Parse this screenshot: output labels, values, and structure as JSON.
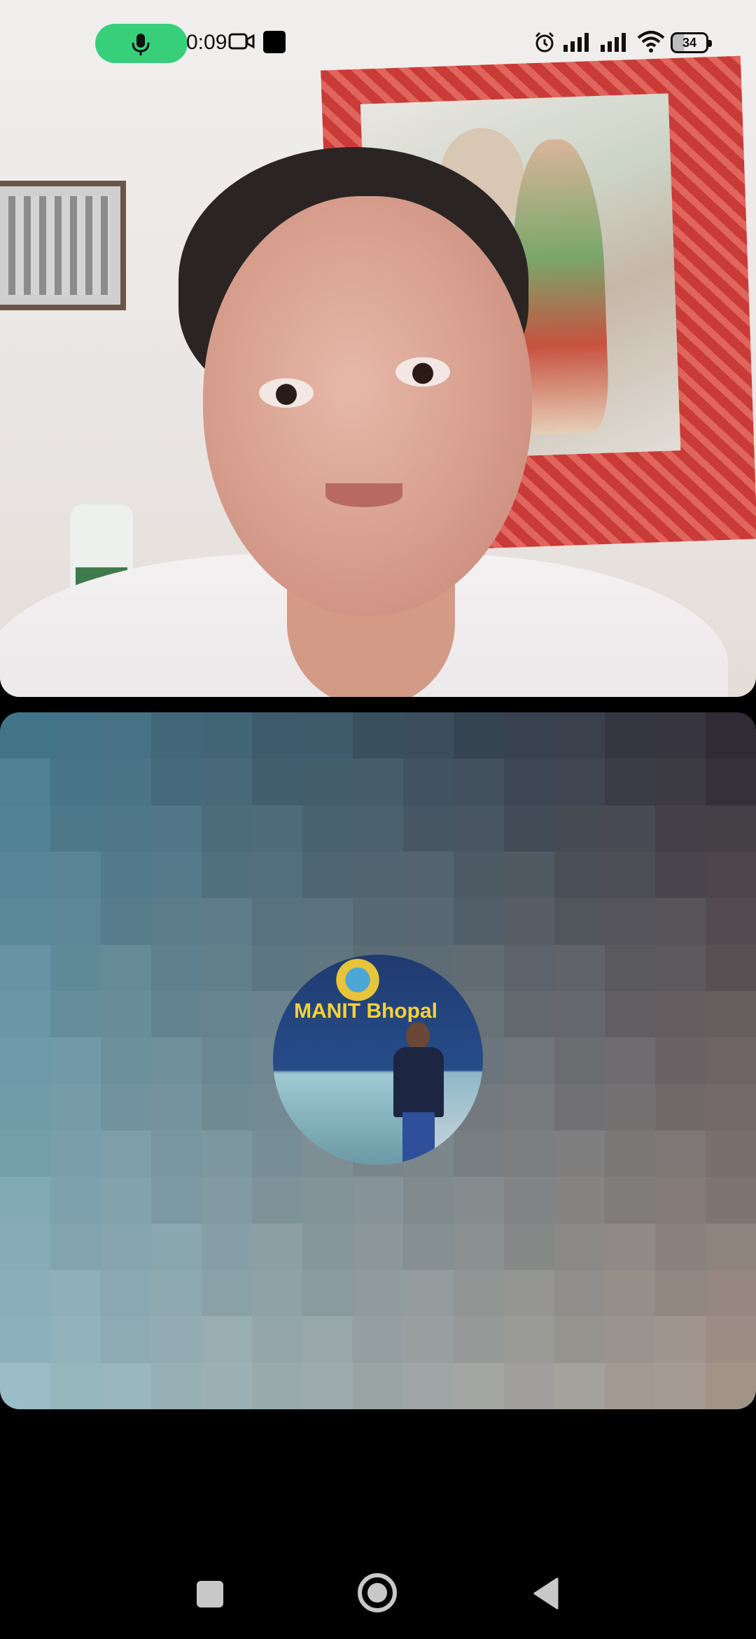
{
  "status_bar": {
    "time": "0:09",
    "battery_level": "34",
    "icons": [
      "microphone-icon",
      "camera-icon",
      "square-icon",
      "alarm-icon",
      "signal-icon",
      "signal-icon",
      "wifi-icon",
      "battery-icon"
    ],
    "mic_pill_color": "#37cf79"
  },
  "remote_video": {
    "description_icons": []
  },
  "local_tile": {
    "avatar_sign_text": "MANIT Bhopal"
  },
  "nav_bar": {
    "buttons": [
      "recents-button",
      "home-button",
      "back-button"
    ]
  }
}
